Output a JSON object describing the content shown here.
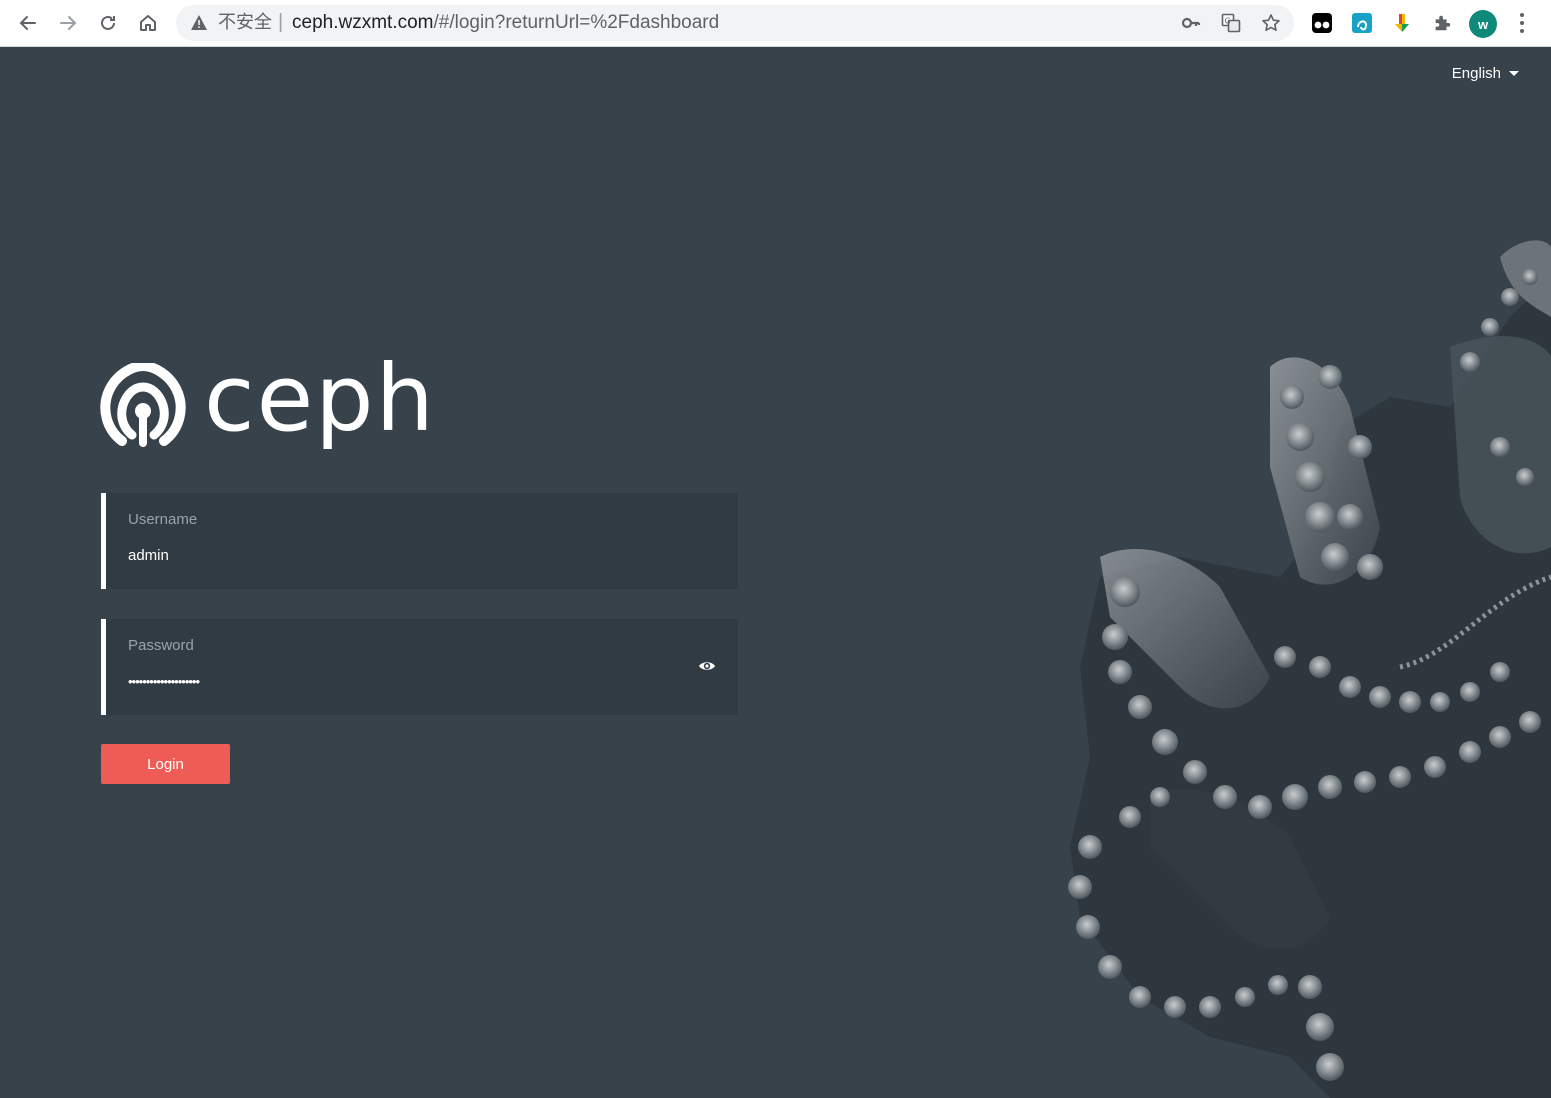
{
  "browser": {
    "security_label": "不安全",
    "separator": "|",
    "url_host": "ceph.wzxmt.com",
    "url_path": "/#/login?returnUrl=%2Fdashboard",
    "profile_initial": "w"
  },
  "header": {
    "language": "English"
  },
  "brand": {
    "logo_text": "ceph"
  },
  "login_form": {
    "username_label": "Username",
    "username_value": "admin",
    "password_label": "Password",
    "password_value": "••••••••••••••••••••",
    "login_button": "Login"
  },
  "colors": {
    "background": "#37424a",
    "field_background": "#313b43",
    "accent": "#ef5c55",
    "text": "#ffffff"
  },
  "icons": [
    "back-icon",
    "forward-icon",
    "reload-icon",
    "home-icon",
    "warning-icon",
    "key-icon",
    "translate-icon",
    "star-icon",
    "extension-icon",
    "eye-icon",
    "caret-down-icon",
    "ceph-logo-icon"
  ]
}
